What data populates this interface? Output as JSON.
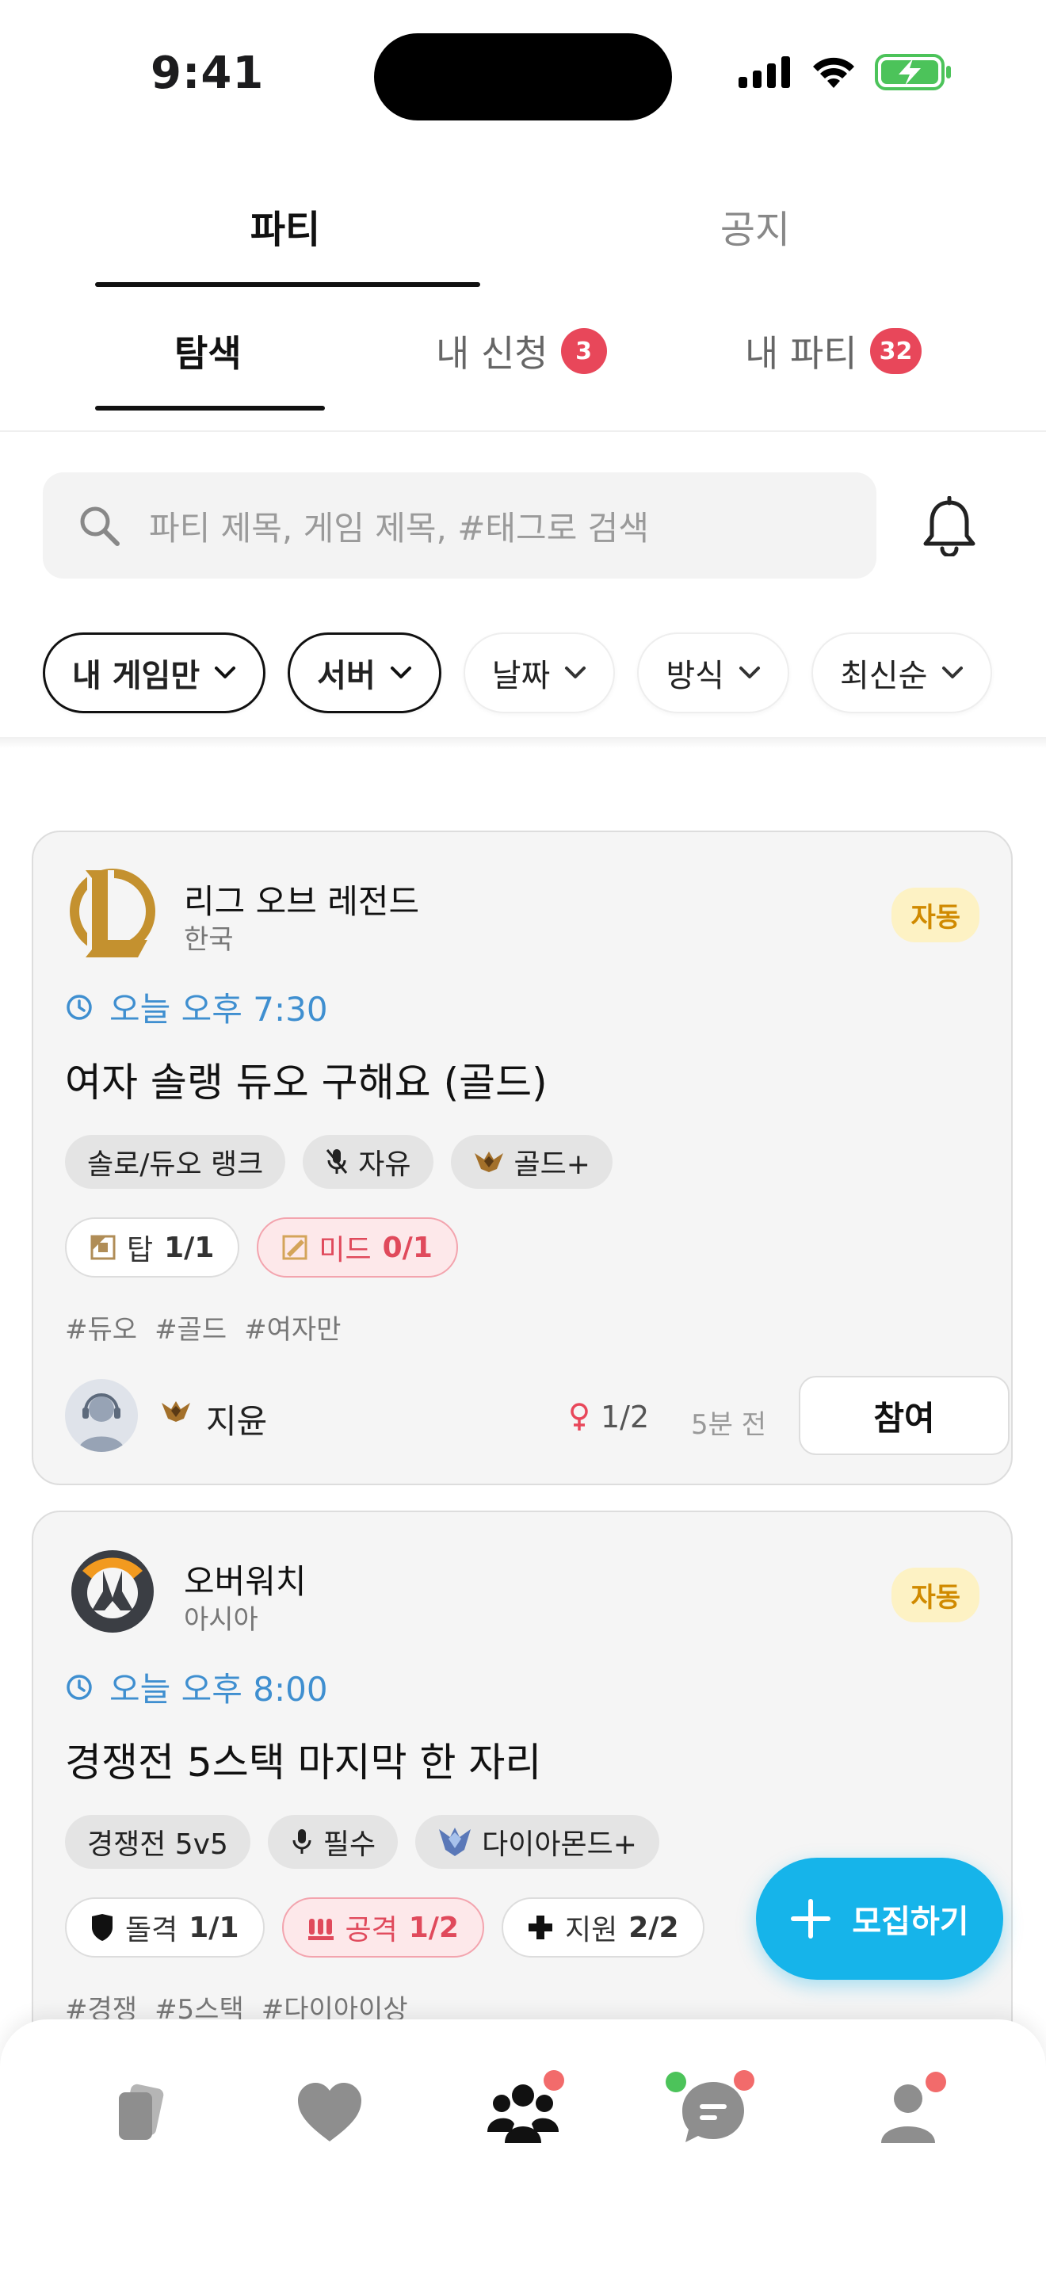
{
  "status_bar": {
    "time": "9:41"
  },
  "top_tabs": [
    {
      "label": "파티"
    },
    {
      "label": "공지"
    }
  ],
  "sub_tabs": [
    {
      "label": "탐색"
    },
    {
      "label": "내 신청",
      "badge": "3"
    },
    {
      "label": "내 파티",
      "badge": "32"
    }
  ],
  "search": {
    "placeholder": "파티 제목, 게임 제목, #태그로 검색"
  },
  "filters": [
    {
      "label": "내 게임만",
      "active": true
    },
    {
      "label": "서버",
      "active": true
    },
    {
      "label": "날짜",
      "active": false
    },
    {
      "label": "방식",
      "active": false
    },
    {
      "label": "최신순",
      "active": false
    }
  ],
  "parties": [
    {
      "game": "리그 오브 레전드",
      "server": "한국",
      "badge": "자동",
      "time": "오늘 오후 7:30",
      "title": "여자 솔랭 듀오 구해요 (골드)",
      "mode": "솔로/듀오 랭크",
      "voice": "자유",
      "rank": "골드+",
      "positions": [
        {
          "label": "탑",
          "count": "1/1",
          "open": false
        },
        {
          "label": "미드",
          "count": "0/1",
          "open": true
        }
      ],
      "hashtags": [
        "#듀오",
        "#골드",
        "#여자만"
      ],
      "host": "지윤",
      "members": "1/2",
      "ago": "5분 전",
      "join_label": "참여"
    },
    {
      "game": "오버워치",
      "server": "아시아",
      "badge": "자동",
      "time": "오늘 오후 8:00",
      "title": "경쟁전 5스택 마지막 한 자리",
      "mode": "경쟁전 5v5",
      "voice": "필수",
      "rank": "다이아몬드+",
      "positions": [
        {
          "label": "돌격",
          "count": "1/1",
          "open": false
        },
        {
          "label": "공격",
          "count": "1/2",
          "open": true
        },
        {
          "label": "지원",
          "count": "2/2",
          "open": false
        }
      ],
      "hashtags": [
        "#경쟁",
        "#5스택",
        "#다이아이상"
      ]
    }
  ],
  "fab": {
    "label": "모집하기"
  },
  "colors": {
    "accent": "#16b4ea",
    "badge": "#e8475a",
    "time": "#3f8fd0",
    "auto_bg": "#fdf2c4",
    "auto_text": "#d08a00"
  },
  "bottom_nav": [
    {
      "icon": "cards-icon",
      "dot": false
    },
    {
      "icon": "heart-icon",
      "dot": false
    },
    {
      "icon": "party-icon",
      "dot": true
    },
    {
      "icon": "chat-icon",
      "dot": true
    },
    {
      "icon": "profile-icon",
      "dot": true
    }
  ]
}
